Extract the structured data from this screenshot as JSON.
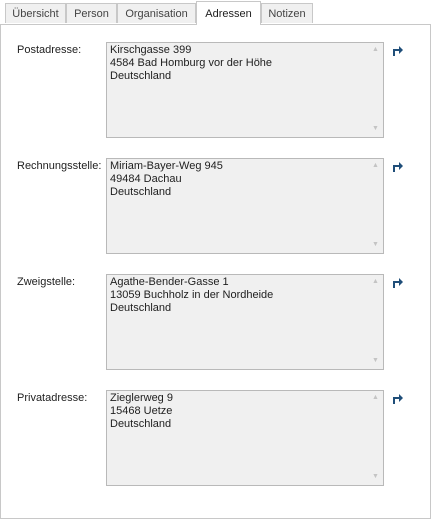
{
  "tabs": [
    {
      "label": "Übersicht",
      "active": false
    },
    {
      "label": "Person",
      "active": false
    },
    {
      "label": "Organisation",
      "active": false
    },
    {
      "label": "Adressen",
      "active": true
    },
    {
      "label": "Notizen",
      "active": false
    }
  ],
  "addresses": [
    {
      "label": "Postadresse:",
      "text": "Kirschgasse 399\n4584 Bad Homburg vor der Höhe\nDeutschland"
    },
    {
      "label": "Rechnungsstelle:",
      "text": "Miriam-Bayer-Weg 945\n49484 Dachau\nDeutschland"
    },
    {
      "label": "Zweigstelle:",
      "text": "Agathe-Bender-Gasse 1\n13059 Buchholz in der Nordheide\nDeutschland"
    },
    {
      "label": "Privatadresse:",
      "text": "Zieglerweg 9\n15468 Uetze\nDeutschland"
    }
  ],
  "icons": {
    "scroll_up": "triangle-up",
    "scroll_down": "triangle-down",
    "edit": "edit-address-icon"
  },
  "colors": {
    "icon_blue": "#1f4e79",
    "field_background": "#f0f0f0",
    "border": "#c8c8c8"
  }
}
